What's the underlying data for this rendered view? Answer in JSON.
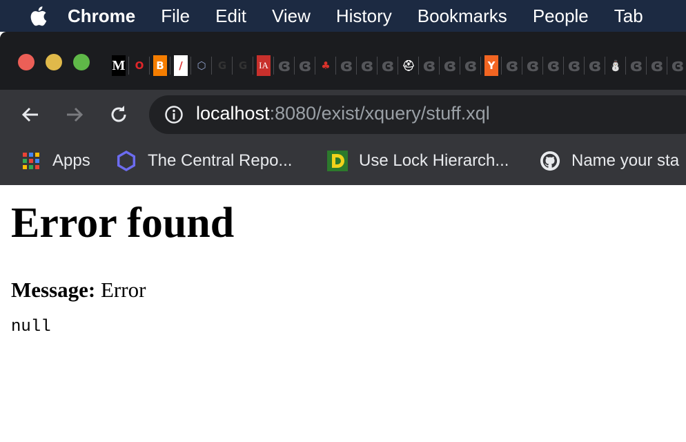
{
  "menubar": {
    "items": [
      "Chrome",
      "File",
      "Edit",
      "View",
      "History",
      "Bookmarks",
      "People",
      "Tab"
    ]
  },
  "tabs": {
    "favicons": [
      {
        "name": "medium-favicon",
        "glyph": "M",
        "bg": "#000000"
      },
      {
        "name": "opera-favicon",
        "glyph": "O",
        "bg": "#1b1c1f",
        "color": "#e0262a"
      },
      {
        "name": "blogger-favicon",
        "glyph": "B",
        "bg": "#f57d00"
      },
      {
        "name": "feather-favicon",
        "glyph": "/",
        "bg": "#ffffff",
        "color": "#d33"
      },
      {
        "name": "hex-favicon",
        "glyph": "⬡",
        "bg": "#1b1c1f",
        "color": "#8fa0c8"
      },
      {
        "name": "spinner-favicon",
        "glyph": "G",
        "bg": "#1b1c1f",
        "color": "#333"
      },
      {
        "name": "spinner-favicon",
        "glyph": "G",
        "bg": "#1b1c1f",
        "color": "#333"
      },
      {
        "name": "ia-favicon",
        "glyph": "IA",
        "bg": "#c8302c"
      },
      {
        "name": "loading-favicon",
        "glyph": "ɞ",
        "bg": "#1b1c1f",
        "color": "#55565a"
      },
      {
        "name": "loading-favicon",
        "glyph": "ɞ",
        "bg": "#1b1c1f",
        "color": "#55565a"
      },
      {
        "name": "maple-favicon",
        "glyph": "♣",
        "bg": "#1b1c1f",
        "color": "#d8322b"
      },
      {
        "name": "loading-favicon",
        "glyph": "ɞ",
        "bg": "#1b1c1f",
        "color": "#55565a"
      },
      {
        "name": "loading-favicon",
        "glyph": "ɞ",
        "bg": "#1b1c1f",
        "color": "#55565a"
      },
      {
        "name": "loading-favicon",
        "glyph": "ɞ",
        "bg": "#1b1c1f",
        "color": "#55565a"
      },
      {
        "name": "helmet-favicon",
        "glyph": "⛑",
        "bg": "#1b1c1f",
        "color": "#ffffff"
      },
      {
        "name": "loading-favicon",
        "glyph": "ɞ",
        "bg": "#1b1c1f",
        "color": "#55565a"
      },
      {
        "name": "loading-favicon",
        "glyph": "ɞ",
        "bg": "#1b1c1f",
        "color": "#55565a"
      },
      {
        "name": "loading-favicon",
        "glyph": "ɞ",
        "bg": "#1b1c1f",
        "color": "#55565a"
      },
      {
        "name": "ycombinator-favicon",
        "glyph": "Y",
        "bg": "#f26522"
      },
      {
        "name": "loading-favicon",
        "glyph": "ɞ",
        "bg": "#1b1c1f",
        "color": "#55565a"
      },
      {
        "name": "loading-favicon",
        "glyph": "ɞ",
        "bg": "#1b1c1f",
        "color": "#55565a"
      },
      {
        "name": "loading-favicon",
        "glyph": "ɞ",
        "bg": "#1b1c1f",
        "color": "#55565a"
      },
      {
        "name": "loading-favicon",
        "glyph": "ɞ",
        "bg": "#1b1c1f",
        "color": "#55565a"
      },
      {
        "name": "loading-favicon",
        "glyph": "ɞ",
        "bg": "#1b1c1f",
        "color": "#55565a"
      },
      {
        "name": "jenkins-favicon",
        "glyph": "⛄",
        "bg": "#1b1c1f",
        "color": "#5b9bd5"
      },
      {
        "name": "loading-favicon",
        "glyph": "ɞ",
        "bg": "#1b1c1f",
        "color": "#55565a"
      },
      {
        "name": "loading-favicon",
        "glyph": "ɞ",
        "bg": "#1b1c1f",
        "color": "#55565a"
      },
      {
        "name": "loading-favicon",
        "glyph": "ɞ",
        "bg": "#1b1c1f",
        "color": "#55565a"
      }
    ]
  },
  "omnibox": {
    "host": "localhost",
    "rest": ":8080/exist/xquery/stuff.xql"
  },
  "bookmarks": [
    {
      "label": "Apps",
      "icon": "apps-grid-icon"
    },
    {
      "label": "The Central Repo...",
      "icon": "hexagon-icon"
    },
    {
      "label": "Use Lock Hierarch...",
      "icon": "d-logo-icon"
    },
    {
      "label": "Name your sta",
      "icon": "github-icon"
    }
  ],
  "page": {
    "title": "Error found",
    "message_label": "Message:",
    "message_value": "Error",
    "detail": "null"
  },
  "colors": {
    "menubar": "#1c2a42",
    "tabstrip": "#1b1c1f",
    "toolbar": "#35363a",
    "omnibox": "#202124"
  }
}
